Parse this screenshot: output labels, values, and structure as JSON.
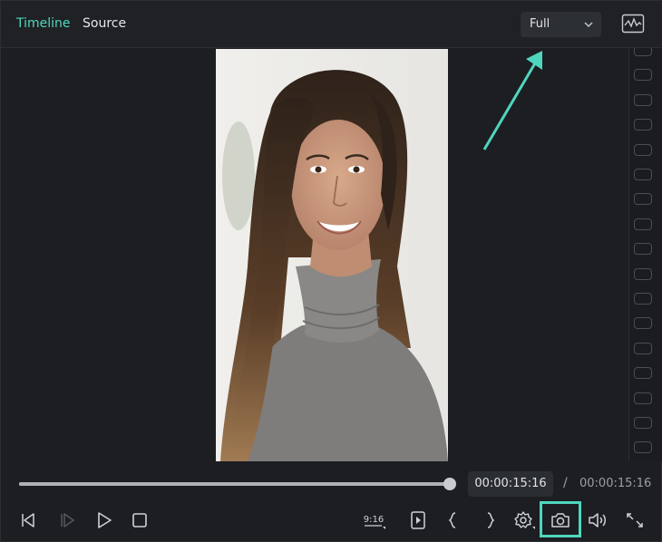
{
  "header": {
    "tabs": [
      {
        "label": "Timeline",
        "active": true
      },
      {
        "label": "Source",
        "active": false
      }
    ],
    "zoom": {
      "selected": "Full"
    }
  },
  "player": {
    "progress": 1.0,
    "current_time": "00:00:15:16",
    "separator": "/",
    "total_time": "00:00:15:16"
  },
  "controls": {
    "aspect_ratio_label": "9:16",
    "left": [
      "previous-frame-icon",
      "next-frame-icon",
      "play-icon",
      "stop-icon"
    ],
    "right": [
      "aspect-ratio-icon",
      "render-preview-icon",
      "mark-in-icon",
      "mark-out-icon",
      "settings-icon",
      "snapshot-icon",
      "volume-icon",
      "fullscreen-icon"
    ]
  },
  "colors": {
    "accent": "#4fd6be",
    "background": "#1c1e22"
  }
}
